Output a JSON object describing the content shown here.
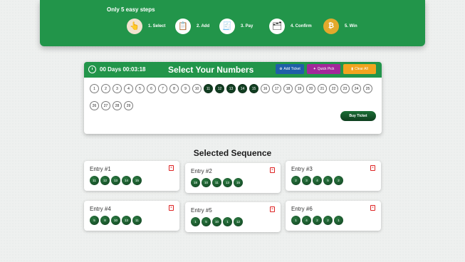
{
  "steps": {
    "title": "Only 5 easy steps",
    "items": [
      {
        "label": "1. Select",
        "icon": "hand-pointer-icon"
      },
      {
        "label": "2. Add",
        "icon": "add-ticket-icon"
      },
      {
        "label": "3. Pay",
        "icon": "invoice-icon"
      },
      {
        "label": "4. Confirm",
        "icon": "confirm-icon"
      },
      {
        "label": "5. Win",
        "icon": "bitcoin-coin-icon"
      }
    ]
  },
  "select": {
    "timer": "00 Days 00:03:18",
    "title": "Select Your Numbers",
    "add_ticket": "Add Ticket",
    "quick_pick": "Quick Pick",
    "clear_all": "Clear All",
    "buy_ticket": "Buy Ticket",
    "numbers_row1": [
      "1",
      "2",
      "3",
      "4",
      "5",
      "6",
      "7",
      "8",
      "9",
      "10",
      "11",
      "12",
      "13",
      "14",
      "15",
      "16",
      "17",
      "18",
      "19",
      "20",
      "21",
      "22",
      "23",
      "24",
      "25"
    ],
    "numbers_row2": [
      "26",
      "27",
      "28",
      "29"
    ],
    "selected": [
      "11",
      "12",
      "13",
      "14",
      "15"
    ]
  },
  "sequence": {
    "title": "Selected Sequence",
    "entries": [
      {
        "label": "Entry #1",
        "balls": [
          "11",
          "12",
          "13",
          "14",
          "15"
        ]
      },
      {
        "label": "Entry #2",
        "balls": [
          "18",
          "10",
          "11",
          "13",
          "15"
        ]
      },
      {
        "label": "Entry #3",
        "balls": [
          "2",
          "3",
          "4",
          "5",
          "2"
        ]
      },
      {
        "label": "Entry #4",
        "balls": [
          "5",
          "8",
          "10",
          "13",
          "11"
        ]
      },
      {
        "label": "Entry #5",
        "balls": [
          "1",
          "5",
          "10",
          "1",
          "12"
        ]
      },
      {
        "label": "Entry #6",
        "balls": [
          "1",
          "4",
          "2",
          "2",
          "1"
        ]
      }
    ]
  },
  "colors": {
    "primary_green": "#22954a",
    "selected_ball": "#123f22",
    "add_ticket": "#1f5fa8",
    "quick_pick": "#a3279a",
    "clear_all": "#f2a41f",
    "delete_red": "#dd2222"
  }
}
